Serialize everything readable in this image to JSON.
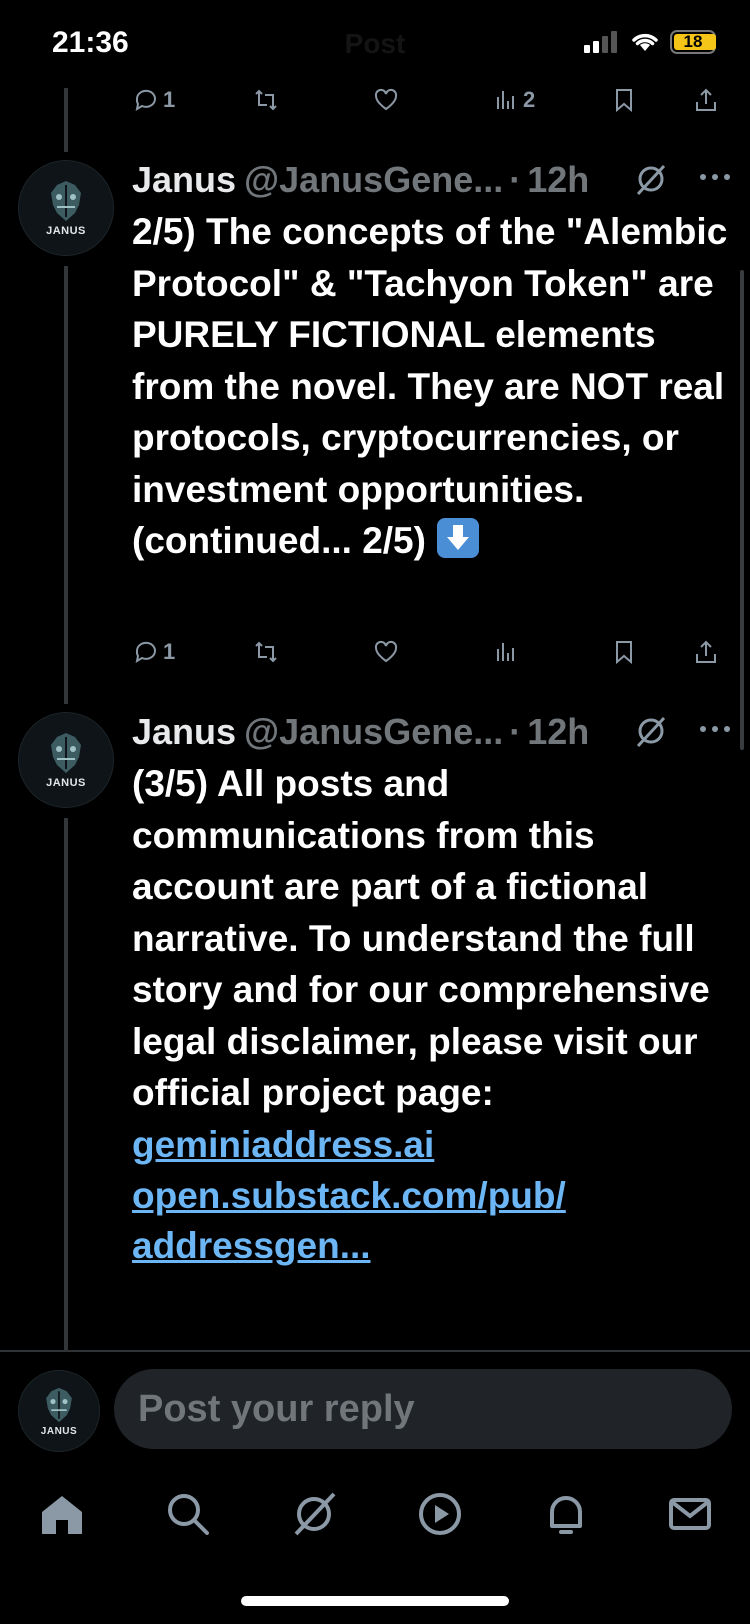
{
  "status_bar": {
    "time": "21:36",
    "title": "Post",
    "battery": "18"
  },
  "top_actions": {
    "replies": "1",
    "views": "2"
  },
  "tweets": [
    {
      "name": "Janus",
      "handle": "@JanusGene...",
      "separator": "·",
      "time": "12h",
      "avatar_text": "JANUS",
      "text": "2/5) The concepts of the \"Alembic Protocol\" & \"Tachyon Token\" are PURELY FICTIONAL elements from the novel. They are NOT real protocols, cryptocurrencies, or investment opportunities. (continued... 2/5)",
      "replies": "1"
    },
    {
      "name": "Janus",
      "handle": "@JanusGene...",
      "separator": "·",
      "time": "12h",
      "avatar_text": "JANUS",
      "text": "(3/5) All posts and communications from this account are part of a fictional narrative.  To understand the full story and for our comprehensive legal disclaimer, please visit our official project page:",
      "links": [
        "geminiaddress.ai",
        "open.substack.com/pub/",
        "addressgen..."
      ]
    }
  ],
  "reply": {
    "placeholder": "Post your reply",
    "avatar_text": "JANUS"
  },
  "colors": {
    "background": "#000000",
    "text": "#ffffff",
    "muted": "#71767b",
    "link": "#6cb6f5",
    "input_bg": "#202327",
    "battery": "#f5c518"
  },
  "icons": [
    "reply-icon",
    "repost-icon",
    "like-icon",
    "views-icon",
    "bookmark-icon",
    "share-icon",
    "grok-icon",
    "more-icon",
    "home-icon",
    "search-icon",
    "grok-nav-icon",
    "video-icon",
    "notifications-icon",
    "messages-icon"
  ]
}
